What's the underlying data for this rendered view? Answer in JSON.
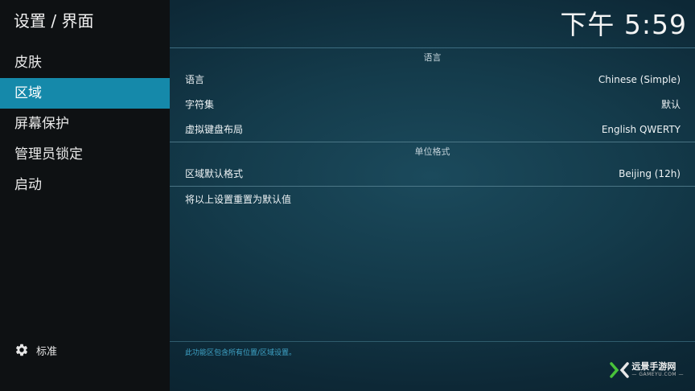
{
  "header": {
    "breadcrumb": "设置 / 界面",
    "clock": "下午 5:59"
  },
  "sidebar": {
    "items": [
      {
        "label": "皮肤",
        "active": false
      },
      {
        "label": "区域",
        "active": true
      },
      {
        "label": "屏幕保护",
        "active": false
      },
      {
        "label": "管理员锁定",
        "active": false
      },
      {
        "label": "启动",
        "active": false
      }
    ],
    "level_icon": "gear-icon",
    "level_label": "标准"
  },
  "content": {
    "sections": [
      {
        "title": "语言",
        "rows": [
          {
            "label": "语言",
            "value": "Chinese (Simple)"
          },
          {
            "label": "字符集",
            "value": "默认"
          },
          {
            "label": "虚拟键盘布局",
            "value": "English QWERTY"
          }
        ]
      },
      {
        "title": "单位格式",
        "rows": [
          {
            "label": "区域默认格式",
            "value": "Beijing (12h)"
          }
        ]
      }
    ],
    "reset_label": "将以上设置重置为默认值"
  },
  "footer": {
    "description": "此功能区包含所有位置/区域设置。"
  },
  "watermark": {
    "main": "远景手游网",
    "sub": "— GAMEYU.COM —"
  },
  "colors": {
    "accent": "#1589aa",
    "sidebar_bg": "#0e1113",
    "footnote": "#3fa4c8"
  }
}
